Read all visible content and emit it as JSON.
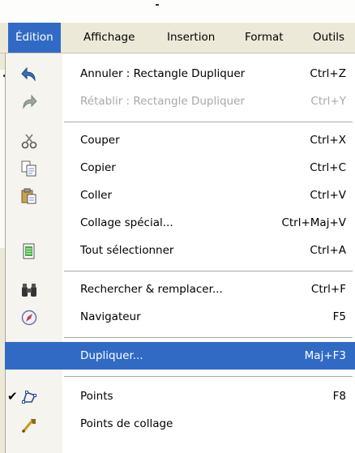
{
  "menubar": {
    "items": [
      "Édition",
      "Affichage",
      "Insertion",
      "Format",
      "Outils"
    ]
  },
  "menu": {
    "items": [
      {
        "label": "Annuler : Rectangle Dupliquer",
        "shortcut": "Ctrl+Z",
        "icon": "undo-icon"
      },
      {
        "label": "Rétablir : Rectangle Dupliquer",
        "shortcut": "Ctrl+Y",
        "icon": "redo-icon",
        "disabled": true
      },
      {
        "label": "Couper",
        "shortcut": "Ctrl+X",
        "icon": "scissors-icon"
      },
      {
        "label": "Copier",
        "shortcut": "Ctrl+C",
        "icon": "copy-icon"
      },
      {
        "label": "Coller",
        "shortcut": "Ctrl+V",
        "icon": "paste-icon"
      },
      {
        "label": "Collage spécial...",
        "shortcut": "Ctrl+Maj+V",
        "icon": ""
      },
      {
        "label": "Tout sélectionner",
        "shortcut": "Ctrl+A",
        "icon": "select-all-icon"
      },
      {
        "label": "Rechercher & remplacer...",
        "shortcut": "Ctrl+F",
        "icon": "binoculars-icon"
      },
      {
        "label": "Navigateur",
        "shortcut": "F5",
        "icon": "navigator-compass-icon"
      },
      {
        "label": "Dupliquer...",
        "shortcut": "Maj+F3",
        "icon": "",
        "highlighted": true
      },
      {
        "label": "Points",
        "shortcut": "F8",
        "icon": "points-icon",
        "checked": true
      },
      {
        "label": "Points de collage",
        "shortcut": "",
        "icon": "glue-points-icon"
      }
    ]
  },
  "colors": {
    "highlight": "#316ac5",
    "menubar": "#ece9d8",
    "disabled_text": "#a8a8a8"
  }
}
